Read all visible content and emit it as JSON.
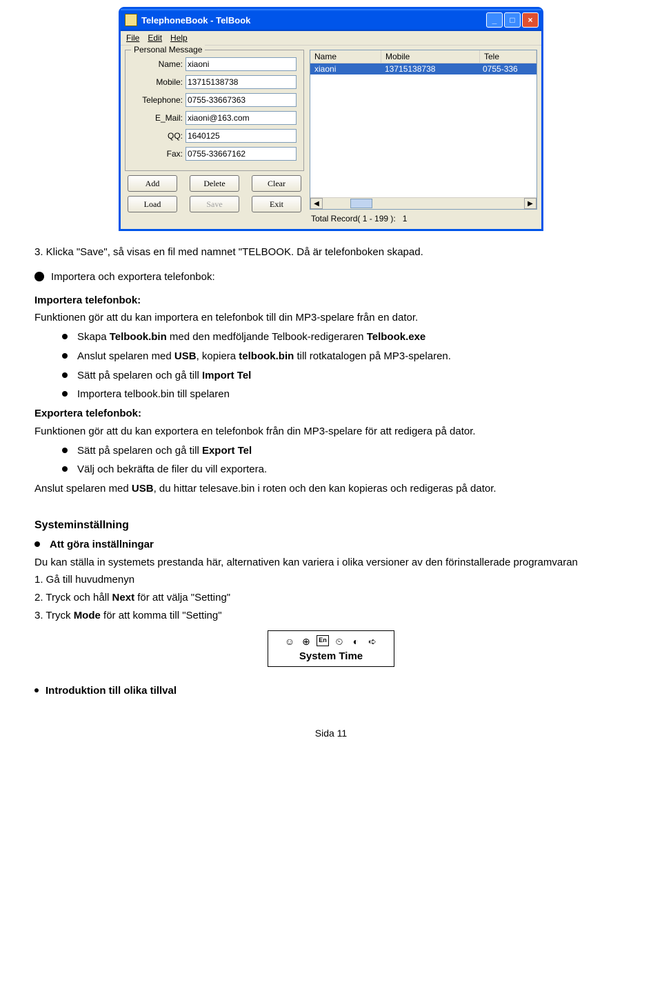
{
  "window": {
    "title": "TelephoneBook - TelBook",
    "menu": {
      "file": "File",
      "edit": "Edit",
      "help": "Help"
    },
    "group_caption": "Personal Message",
    "labels": {
      "name": "Name:",
      "mobile": "Mobile:",
      "telephone": "Telephone:",
      "email": "E_Mail:",
      "qq": "QQ:",
      "fax": "Fax:"
    },
    "values": {
      "name": "xiaoni",
      "mobile": "13715138738",
      "telephone": "0755-33667363",
      "email": "xiaoni@163.com",
      "qq": "1640125",
      "fax": "0755-33667162"
    },
    "buttons": {
      "add": "Add",
      "delete": "Delete",
      "clear": "Clear",
      "load": "Load",
      "save": "Save",
      "exit": "Exit"
    },
    "list": {
      "cols": {
        "name": "Name",
        "mobile": "Mobile",
        "tele": "Tele"
      },
      "row": {
        "name": "xiaoni",
        "mobile": "13715138738",
        "tele": "0755-336"
      }
    },
    "total_label": "Total Record( 1 - 199 ):",
    "total_value": "1"
  },
  "doc": {
    "step3": "3. Klicka \"Save\", så visas en fil med namnet \"TELBOOK. Då är telefonboken skapad.",
    "imp_exp_header": "Importera och exportera telefonbok:",
    "imp_header": "Importera telefonbok:",
    "imp_intro": "Funktionen gör att du kan importera en telefonbok till din MP3-spelare från en dator.",
    "imp_b1_a": "Skapa ",
    "imp_b1_b": "Telbook.bin",
    "imp_b1_c": " med den medföljande Telbook-redigeraren ",
    "imp_b1_d": "Telbook.exe",
    "imp_b2_a": "Anslut spelaren med ",
    "imp_b2_b": "USB",
    "imp_b2_c": ", kopiera ",
    "imp_b2_d": "telbook.bin",
    "imp_b2_e": " till rotkatalogen på MP3-spelaren.",
    "imp_b3_a": "Sätt på spelaren och gå till ",
    "imp_b3_b": "Import Tel",
    "imp_b4": "Importera telbook.bin till spelaren",
    "exp_header": "Exportera telefonbok:",
    "exp_intro": "Funktionen gör att du kan exportera en telefonbok från din MP3-spelare för att redigera på dator.",
    "exp_b1_a": "Sätt på spelaren och gå till ",
    "exp_b1_b": "Export Tel",
    "exp_b2": "Välj och bekräfta de filer du vill exportera.",
    "exp_note_a": "Anslut spelaren med ",
    "exp_note_b": "USB",
    "exp_note_c": ", du hittar telesave.bin i roten och den kan kopieras och redigeras på dator.",
    "sys_title": "Systeminställning",
    "sys_att": "Att göra inställningar",
    "sys_desc": "Du kan ställa in systemets prestanda här, alternativen kan variera i olika versioner av den förinstallerade programvaran",
    "sys_step1": "1. Gå till huvudmenyn",
    "sys_step2_a": "2. Tryck och håll ",
    "sys_step2_b": "Next",
    "sys_step2_c": " för att välja \"Setting\"",
    "sys_step3_a": "3. Tryck ",
    "sys_step3_b": "Mode",
    "sys_step3_c": " för att komma till \"Setting\"",
    "st_label": "System Time",
    "intro_header": "Introduktion till olika tillval",
    "footer": "Sida 11"
  }
}
